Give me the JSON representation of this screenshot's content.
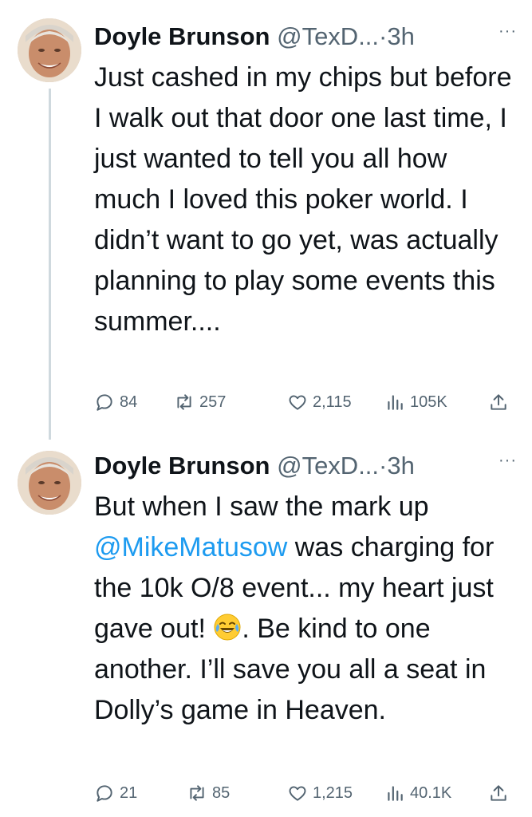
{
  "tweets": [
    {
      "name": "Doyle Brunson",
      "handle": "@TexD...",
      "separator": "·",
      "time": "3h",
      "more": "···",
      "text_parts": [
        "Just cashed in my chips but before I walk out that door one last time, I just wanted to tell you all how much I loved this poker world. I didn’t want to go yet, was actually planning to play some events this summer...."
      ],
      "replies": "84",
      "retweets": "257",
      "likes": "2,115",
      "views": "105K"
    },
    {
      "name": "Doyle Brunson",
      "handle": "@TexD...",
      "separator": "·",
      "time": "3h",
      "more": "···",
      "text_before_mention": "But when I saw the mark up ",
      "mention": "@MikeMatusow",
      "text_after_mention": " was charging for the 10k O/8 event... my heart just gave out! ",
      "emoji": "face-with-tears-of-joy",
      "text_after_emoji": ". Be kind to one another. I’ll save you all a seat in Dolly’s game in Heaven.",
      "replies": "21",
      "retweets": "85",
      "likes": "1,215",
      "views": "40.1K"
    }
  ],
  "colors": {
    "text": "#0f1419",
    "secondary": "#536471",
    "link": "#1d9bf0",
    "thread_line": "#cfd9de"
  }
}
